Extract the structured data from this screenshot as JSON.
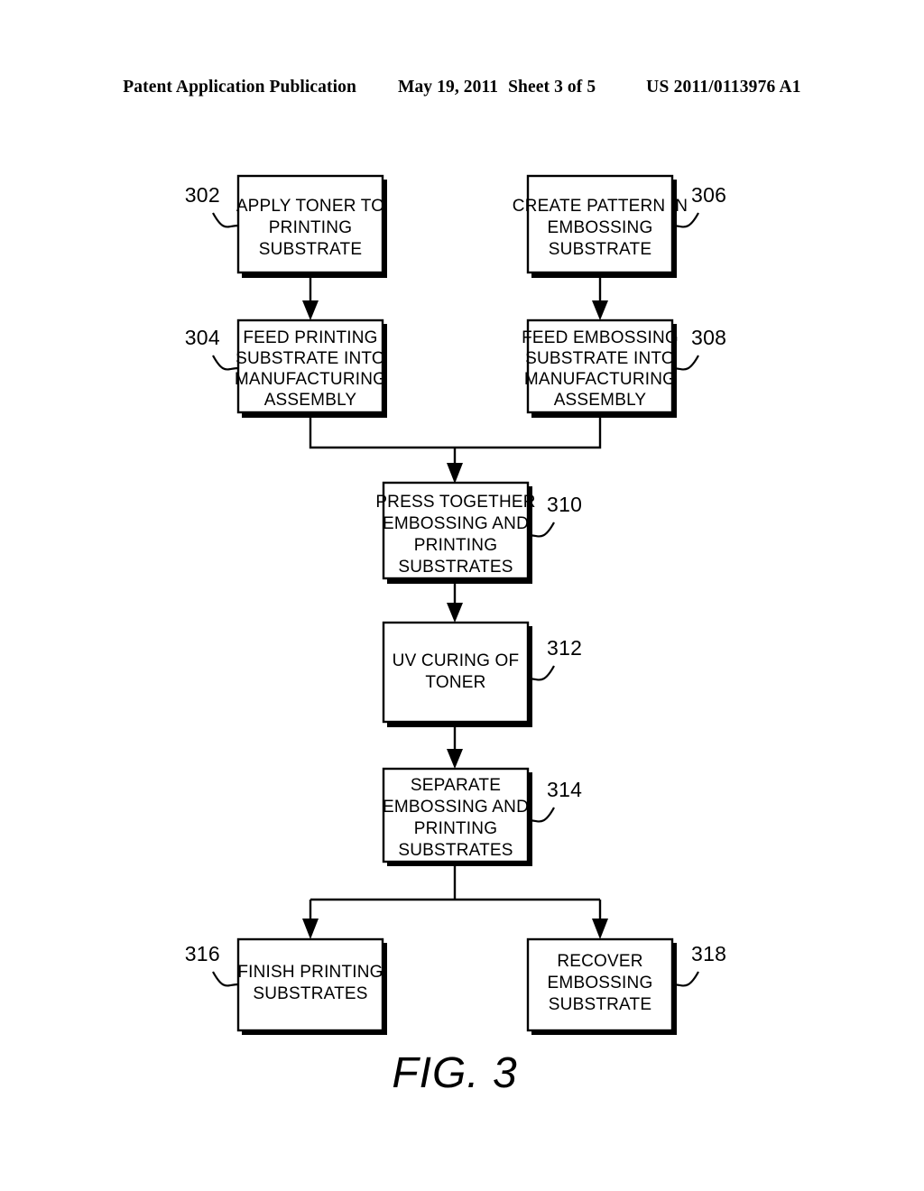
{
  "header": {
    "publication": "Patent Application Publication",
    "date": "May 19, 2011",
    "sheet": "Sheet 3 of 5",
    "patent_number": "US 2011/0113976 A1"
  },
  "figure": {
    "caption": "FIG. 3",
    "type": "flowchart",
    "nodes": [
      {
        "ref": "302",
        "lines": [
          "APPLY TONER TO",
          "PRINTING",
          "SUBSTRATE"
        ],
        "ref_side": "left"
      },
      {
        "ref": "306",
        "lines": [
          "CREATE PATTERN IN",
          "EMBOSSING",
          "SUBSTRATE"
        ],
        "ref_side": "right"
      },
      {
        "ref": "304",
        "lines": [
          "FEED PRINTING",
          "SUBSTRATE INTO",
          "MANUFACTURING",
          "ASSEMBLY"
        ],
        "ref_side": "left"
      },
      {
        "ref": "308",
        "lines": [
          "FEED EMBOSSING",
          "SUBSTRATE INTO",
          "MANUFACTURING",
          "ASSEMBLY"
        ],
        "ref_side": "right"
      },
      {
        "ref": "310",
        "lines": [
          "PRESS TOGETHER",
          "EMBOSSING AND",
          "PRINTING",
          "SUBSTRATES"
        ],
        "ref_side": "right"
      },
      {
        "ref": "312",
        "lines": [
          "UV CURING OF",
          "TONER"
        ],
        "ref_side": "right"
      },
      {
        "ref": "314",
        "lines": [
          "SEPARATE",
          "EMBOSSING AND",
          "PRINTING",
          "SUBSTRATES"
        ],
        "ref_side": "right"
      },
      {
        "ref": "316",
        "lines": [
          "FINISH PRINTING",
          "SUBSTRATES"
        ],
        "ref_side": "left"
      },
      {
        "ref": "318",
        "lines": [
          "RECOVER",
          "EMBOSSING",
          "SUBSTRATE"
        ],
        "ref_side": "right"
      }
    ],
    "edges": [
      {
        "from": "302",
        "to": "304",
        "kind": "straight"
      },
      {
        "from": "306",
        "to": "308",
        "kind": "straight"
      },
      {
        "from": "304",
        "to": "310",
        "kind": "merge"
      },
      {
        "from": "308",
        "to": "310",
        "kind": "merge"
      },
      {
        "from": "310",
        "to": "312",
        "kind": "straight"
      },
      {
        "from": "312",
        "to": "314",
        "kind": "straight"
      },
      {
        "from": "314",
        "to": "316",
        "kind": "split"
      },
      {
        "from": "314",
        "to": "318",
        "kind": "split"
      }
    ]
  },
  "colors": {
    "ink": "#000000",
    "paper": "#ffffff"
  }
}
